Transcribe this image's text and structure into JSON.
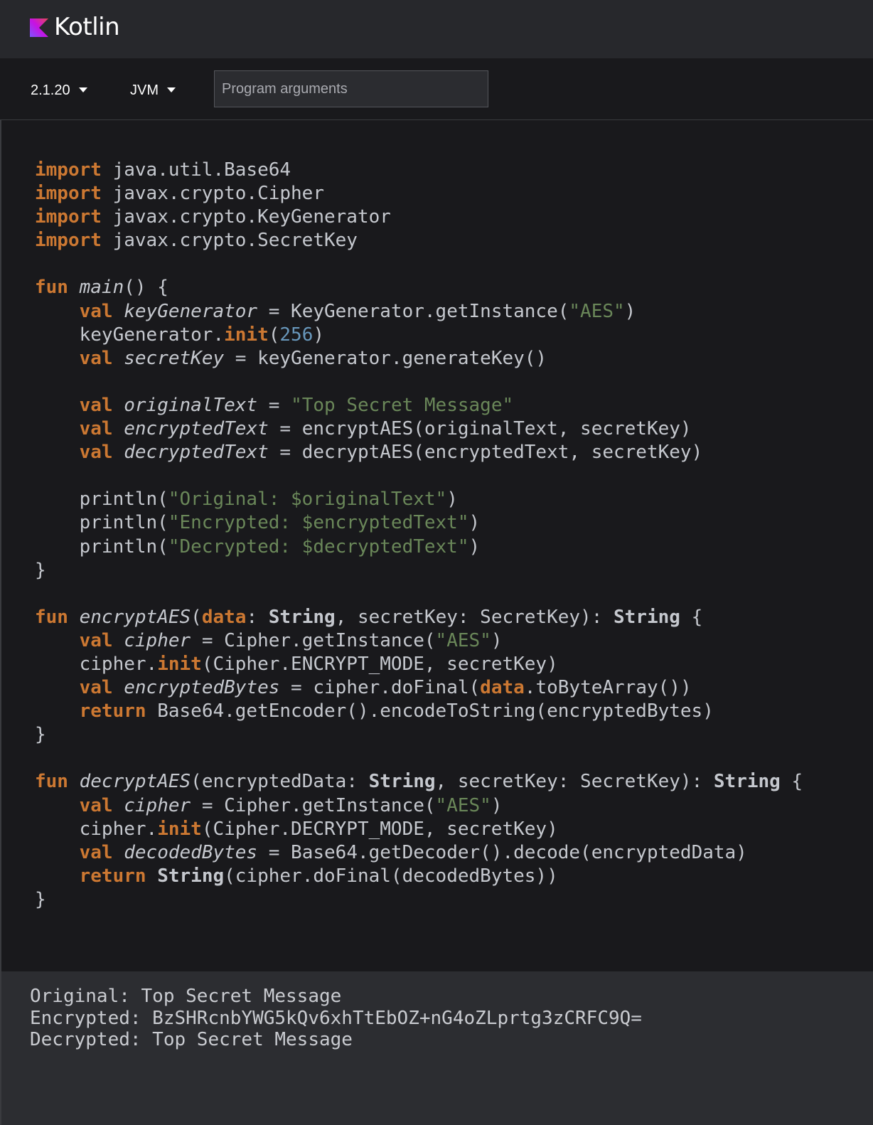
{
  "header": {
    "brand": "Kotlin",
    "logo_icon": "kotlin-logo-icon"
  },
  "toolbar": {
    "version_label": "2.1.20",
    "platform_label": "JVM",
    "args_placeholder": "Program arguments",
    "args_value": ""
  },
  "editor": {
    "language": "kotlin",
    "code_lines": [
      "import java.util.Base64",
      "import javax.crypto.Cipher",
      "import javax.crypto.KeyGenerator",
      "import javax.crypto.SecretKey",
      "",
      "fun main() {",
      "    val keyGenerator = KeyGenerator.getInstance(\"AES\")",
      "    keyGenerator.init(256)",
      "    val secretKey = keyGenerator.generateKey()",
      "",
      "    val originalText = \"Top Secret Message\"",
      "    val encryptedText = encryptAES(originalText, secretKey)",
      "    val decryptedText = decryptAES(encryptedText, secretKey)",
      "",
      "    println(\"Original: $originalText\")",
      "    println(\"Encrypted: $encryptedText\")",
      "    println(\"Decrypted: $decryptedText\")",
      "}",
      "",
      "fun encryptAES(data: String, secretKey: SecretKey): String {",
      "    val cipher = Cipher.getInstance(\"AES\")",
      "    cipher.init(Cipher.ENCRYPT_MODE, secretKey)",
      "    val encryptedBytes = cipher.doFinal(data.toByteArray())",
      "    return Base64.getEncoder().encodeToString(encryptedBytes)",
      "}",
      "",
      "fun decryptAES(encryptedData: String, secretKey: SecretKey): String {",
      "    val cipher = Cipher.getInstance(\"AES\")",
      "    cipher.init(Cipher.DECRYPT_MODE, secretKey)",
      "    val decodedBytes = Base64.getDecoder().decode(encryptedData)",
      "    return String(cipher.doFinal(decodedBytes))",
      "}"
    ]
  },
  "output": {
    "lines": [
      "Original: Top Secret Message",
      "Encrypted: BzSHRcnbYWG5kQv6xhTtEbOZ+nG4oZLprtg3zCRFC9Q=",
      "Decrypted: Top Secret Message"
    ]
  },
  "colors": {
    "background": "#19191c",
    "header": "#27282c",
    "output_bg": "#2c2d31",
    "keyword": "#cc7832",
    "string": "#6a8759",
    "number": "#6897bb",
    "text": "#c5c8ce"
  }
}
